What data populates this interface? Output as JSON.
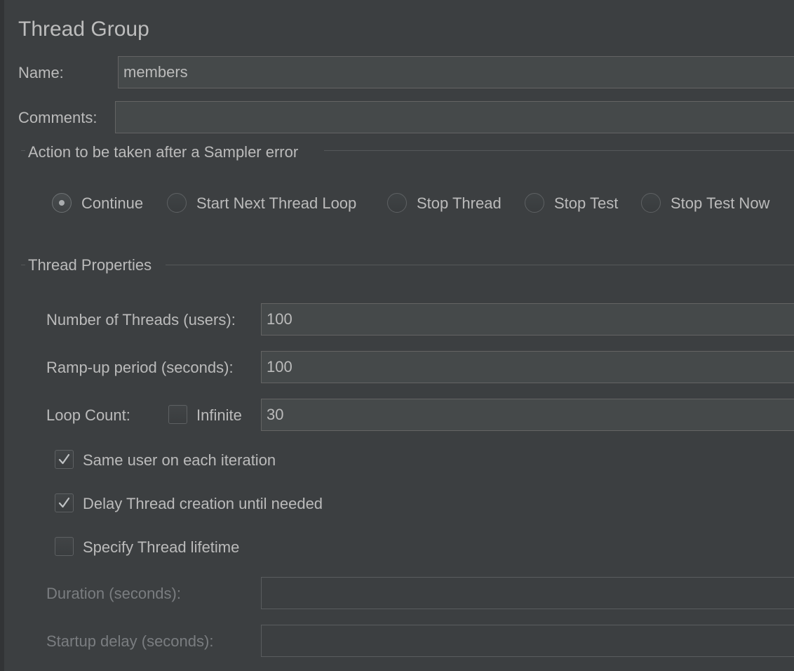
{
  "panel": {
    "title": "Thread Group",
    "name_label": "Name:",
    "name_value": "members",
    "comments_label": "Comments:",
    "comments_value": ""
  },
  "sampler_error": {
    "legend": "Action to be taken after a Sampler error",
    "options": [
      {
        "label": "Continue",
        "selected": true
      },
      {
        "label": "Start Next Thread Loop",
        "selected": false
      },
      {
        "label": "Stop Thread",
        "selected": false
      },
      {
        "label": "Stop Test",
        "selected": false
      },
      {
        "label": "Stop Test Now",
        "selected": false
      }
    ]
  },
  "thread_properties": {
    "legend": "Thread Properties",
    "threads_label": "Number of Threads (users):",
    "threads_value": "100",
    "rampup_label": "Ramp-up period (seconds):",
    "rampup_value": "100",
    "loop_label": "Loop Count:",
    "infinite_label": "Infinite",
    "infinite_checked": false,
    "loop_value": "30",
    "same_user_label": "Same user on each iteration",
    "same_user_checked": true,
    "delay_label": "Delay Thread creation until needed",
    "delay_checked": true,
    "lifetime_label": "Specify Thread lifetime",
    "lifetime_checked": false,
    "duration_label": "Duration (seconds):",
    "duration_value": "",
    "startup_label": "Startup delay (seconds):",
    "startup_value": ""
  },
  "icons": {
    "check": "checkmark-icon",
    "radio_dot": "radio-dot-icon"
  },
  "colors": {
    "background": "#3c3f41",
    "text": "#bbbbbb",
    "disabled_text": "#7a7d80",
    "field_background": "#45494a",
    "field_border": "#646464"
  }
}
